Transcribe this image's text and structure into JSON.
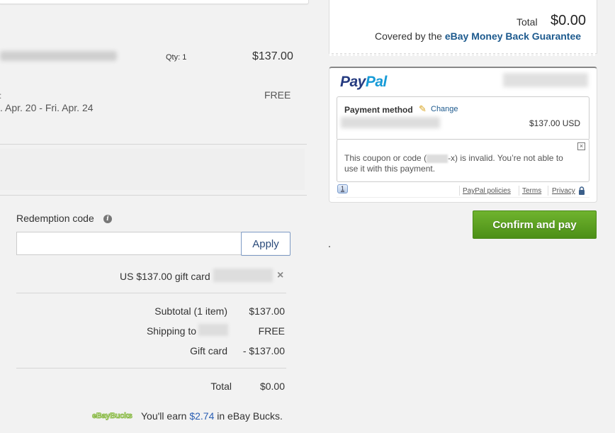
{
  "item": {
    "qty_label": "Qty: 1",
    "price": "$137.00",
    "shipping_cost": "FREE",
    "shipping_dates": ". Apr. 20 - Fri. Apr. 24"
  },
  "redemption": {
    "label": "Redemption code",
    "input_value": "",
    "input_placeholder": "",
    "apply_label": "Apply",
    "applied_giftcard": "US $137.00 gift card",
    "remove_icon": "×"
  },
  "summary": {
    "rows": [
      {
        "label": "Subtotal (1 item)",
        "value": "$137.00"
      },
      {
        "label": "Shipping to",
        "value": "FREE"
      },
      {
        "label": "Gift card",
        "value": "- $137.00"
      }
    ],
    "total_label": "Total",
    "total_value": "$0.00"
  },
  "ebay_bucks": {
    "logo": "eBayBucks",
    "prefix": "You'll earn ",
    "amount": "$2.74",
    "suffix": " in eBay Bucks."
  },
  "order_total": {
    "label": "Total",
    "value": "$0.00",
    "covered_prefix": "Covered by the ",
    "covered_link": "eBay Money Back Guarantee"
  },
  "paypal": {
    "logo_pay": "Pay",
    "logo_pal": "Pal",
    "payment_method_label": "Payment method",
    "change_label": "Change",
    "amount": "$137.00 USD",
    "error_prefix": "This coupon or code (",
    "error_suffix": "-x) is invalid. You’re not able to use it with this payment.",
    "notification_count": "1",
    "links": [
      "PayPal policies",
      "Terms",
      "Privacy"
    ]
  },
  "confirm_button": "Confirm and pay",
  "colors": {
    "link_blue": "#1d5a8e",
    "confirm_green": "#5aa022",
    "paypal_dark": "#253b80",
    "paypal_light": "#179bd7"
  }
}
